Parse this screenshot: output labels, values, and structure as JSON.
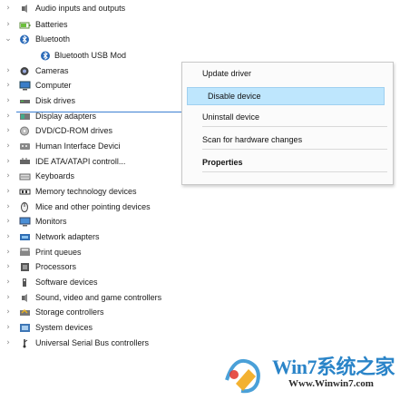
{
  "tree": [
    {
      "label": "Audio inputs and outputs",
      "arrow": "›",
      "icon": "speaker-icon",
      "indent": 0
    },
    {
      "label": "Batteries",
      "arrow": "›",
      "icon": "battery-icon",
      "indent": 0
    },
    {
      "label": "Bluetooth",
      "arrow": "⌄",
      "icon": "bluetooth-icon",
      "indent": 0
    },
    {
      "label": "Bluetooth USB Mod",
      "arrow": "",
      "icon": "bluetooth-icon",
      "indent": 1
    },
    {
      "label": "Cameras",
      "arrow": "›",
      "icon": "camera-icon",
      "indent": 0
    },
    {
      "label": "Computer",
      "arrow": "›",
      "icon": "computer-icon",
      "indent": 0
    },
    {
      "label": "Disk drives",
      "arrow": "›",
      "icon": "disk-drive-icon",
      "indent": 0
    },
    {
      "label": "Display adapters",
      "arrow": "›",
      "icon": "display-adapter-icon",
      "indent": 0
    },
    {
      "label": "DVD/CD-ROM drives",
      "arrow": "›",
      "icon": "dvd-icon",
      "indent": 0
    },
    {
      "label": "Human Interface Devici",
      "arrow": "›",
      "icon": "hid-icon",
      "indent": 0
    },
    {
      "label": "IDE ATA/ATAPI controll...",
      "arrow": "›",
      "icon": "ide-controller-icon",
      "indent": 0
    },
    {
      "label": "Keyboards",
      "arrow": "›",
      "icon": "keyboard-icon",
      "indent": 0
    },
    {
      "label": "Memory technology devices",
      "arrow": "›",
      "icon": "memory-icon",
      "indent": 0
    },
    {
      "label": "Mice and other pointing devices",
      "arrow": "›",
      "icon": "mouse-icon",
      "indent": 0
    },
    {
      "label": "Monitors",
      "arrow": "›",
      "icon": "monitor-icon",
      "indent": 0
    },
    {
      "label": "Network adapters",
      "arrow": "›",
      "icon": "network-adapter-icon",
      "indent": 0
    },
    {
      "label": "Print queues",
      "arrow": "›",
      "icon": "printer-icon",
      "indent": 0
    },
    {
      "label": "Processors",
      "arrow": "›",
      "icon": "processor-icon",
      "indent": 0
    },
    {
      "label": "Software devices",
      "arrow": "›",
      "icon": "software-device-icon",
      "indent": 0
    },
    {
      "label": "Sound, video and game controllers",
      "arrow": "›",
      "icon": "speaker-icon",
      "indent": 0
    },
    {
      "label": "Storage controllers",
      "arrow": "›",
      "icon": "storage-controller-icon",
      "indent": 0
    },
    {
      "label": "System devices",
      "arrow": "›",
      "icon": "system-device-icon",
      "indent": 0
    },
    {
      "label": "Universal Serial Bus controllers",
      "arrow": "›",
      "icon": "usb-icon",
      "indent": 0
    }
  ],
  "context_menu": {
    "items": [
      {
        "label": "Update driver",
        "style": "normal"
      },
      {
        "label": "Disable device",
        "style": "highlight"
      },
      {
        "label": "Uninstall device",
        "style": "normal"
      },
      {
        "label": "Scan for hardware changes",
        "style": "normal"
      },
      {
        "label": "Properties",
        "style": "bold"
      }
    ]
  },
  "watermark": {
    "title": "Win7系统之家",
    "url": "Www.Winwin7.com"
  },
  "colors": {
    "highlight": "#bee6fd",
    "selection_outline": "#3c7fd1",
    "watermark_blue": "#2a84c8"
  }
}
